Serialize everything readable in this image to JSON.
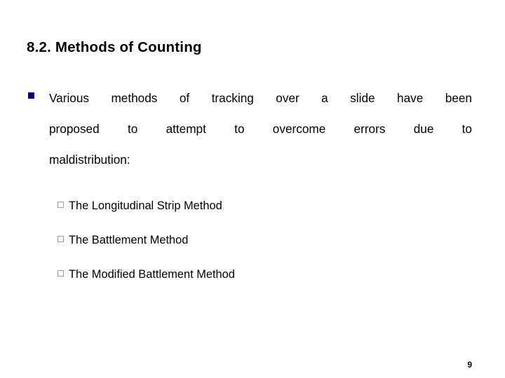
{
  "slide": {
    "title": "8.2. Methods of Counting",
    "page_number": "9",
    "colors": {
      "level1_bullet": "#000080",
      "level2_bullet_border": "#9a9ab0",
      "background": "#ffffff",
      "text": "#000000"
    },
    "level1": {
      "bullet_icon": "filled-square-bullet",
      "full_text": "Various methods of tracking over a slide have been proposed to attempt to overcome errors due to maldistribution:",
      "lines": [
        "Various methods of tracking over a slide have been",
        "proposed to attempt to overcome errors due to",
        "maldistribution:"
      ]
    },
    "level2": {
      "bullet_icon": "hollow-square-bullet",
      "items": [
        {
          "label": "The Longitudinal Strip Method"
        },
        {
          "label": "The Battlement Method"
        },
        {
          "label": "The Modified Battlement Method"
        }
      ]
    }
  }
}
